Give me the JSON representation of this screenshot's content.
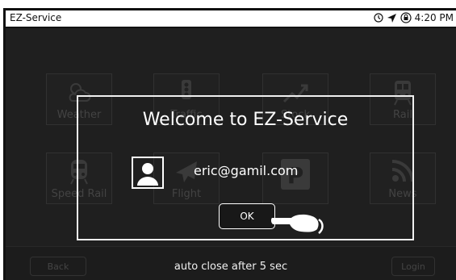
{
  "status_bar": {
    "app_title": "EZ-Service",
    "time": "4:20 PM",
    "icons": [
      "clock-icon",
      "location-arrow-icon",
      "lock-rotation-icon"
    ]
  },
  "tiles": [
    {
      "label": "Weather",
      "icon": "weather-icon"
    },
    {
      "label": "Traffic",
      "icon": "traffic-light-icon"
    },
    {
      "label": "Stock",
      "icon": "stock-chart-icon"
    },
    {
      "label": "Rail",
      "icon": "train-icon"
    },
    {
      "label": "Speed Rail",
      "icon": "speed-rail-icon"
    },
    {
      "label": "Flight",
      "icon": "airplane-icon"
    },
    {
      "label": "",
      "icon": "parking-icon"
    },
    {
      "label": "News",
      "icon": "rss-icon"
    }
  ],
  "nav": {
    "back_label": "Back",
    "login_label": "Login"
  },
  "dialog": {
    "title": "Welcome to EZ-Service",
    "email": "eric@gamil.com",
    "ok_label": "OK",
    "auto_close_text": "auto close after 5 sec"
  }
}
